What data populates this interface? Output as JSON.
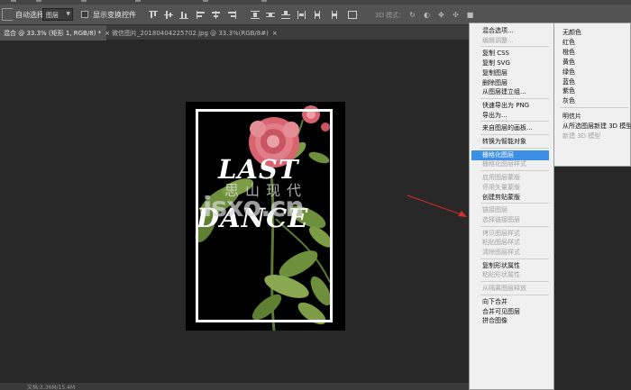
{
  "options_bar": {
    "auto_select_label": "自动选择：",
    "auto_select_value": "图层",
    "show_transform_label": "显示变换控件",
    "mode_3d_label": "3D 模式："
  },
  "tabs": [
    {
      "label": "混合 @ 33.3% (矩形 1, RGB/8) *",
      "close": "×"
    },
    {
      "label": "微信图片_20180404225702.jpg @ 33.3%(RGB/8#)",
      "close": "×"
    }
  ],
  "poster": {
    "line1": "LAST",
    "line2": "DANCE",
    "colors": {
      "rose": "#d9636e",
      "leaf": "#6e8f3c"
    }
  },
  "watermark": {
    "cn": "思山现代",
    "latin": "isxo.cn"
  },
  "status": {
    "text": "文档:3.36M/15.4M"
  },
  "context_menu": {
    "items": [
      {
        "label": "混合选项...",
        "disabled": false
      },
      {
        "label": "编辑调整...",
        "disabled": true
      },
      {
        "sep": true
      },
      {
        "label": "复制 CSS",
        "disabled": false
      },
      {
        "label": "复制 SVG",
        "disabled": false
      },
      {
        "label": "复制图层",
        "disabled": false
      },
      {
        "label": "删除图层",
        "disabled": false
      },
      {
        "label": "从图层建立组...",
        "disabled": false
      },
      {
        "sep": true
      },
      {
        "label": "快速导出为 PNG",
        "disabled": false
      },
      {
        "label": "导出为...",
        "disabled": false
      },
      {
        "sep": true
      },
      {
        "label": "来自图层的画板...",
        "disabled": false
      },
      {
        "sep": true
      },
      {
        "label": "转换为智能对象",
        "disabled": false
      },
      {
        "sep": true
      },
      {
        "label": "栅格化图层",
        "disabled": false,
        "highlighted": true
      },
      {
        "label": "栅格化图层样式",
        "disabled": true
      },
      {
        "sep": true
      },
      {
        "label": "启用图层蒙版",
        "disabled": true
      },
      {
        "label": "停用矢量蒙版",
        "disabled": true
      },
      {
        "label": "创建剪贴蒙版",
        "disabled": false
      },
      {
        "sep": true
      },
      {
        "label": "链接图层",
        "disabled": true
      },
      {
        "label": "选择链接图层",
        "disabled": true
      },
      {
        "sep": true
      },
      {
        "label": "拷贝图层样式",
        "disabled": true
      },
      {
        "label": "粘贴图层样式",
        "disabled": true
      },
      {
        "label": "清除图层样式",
        "disabled": true
      },
      {
        "sep": true
      },
      {
        "label": "复制形状属性",
        "disabled": false
      },
      {
        "label": "粘贴形状属性",
        "disabled": true
      },
      {
        "sep": true
      },
      {
        "label": "从隔离图层释放",
        "disabled": true
      },
      {
        "sep": true
      },
      {
        "label": "向下合并",
        "disabled": false
      },
      {
        "label": "合并可见图层",
        "disabled": false
      },
      {
        "label": "拼合图像",
        "disabled": false
      }
    ]
  },
  "color_submenu": {
    "items": [
      {
        "label": "无颜色",
        "disabled": false
      },
      {
        "label": "红色",
        "disabled": false
      },
      {
        "label": "橙色",
        "disabled": false
      },
      {
        "label": "黄色",
        "disabled": false
      },
      {
        "label": "绿色",
        "disabled": false
      },
      {
        "label": "蓝色",
        "disabled": false
      },
      {
        "label": "紫色",
        "disabled": false
      },
      {
        "label": "灰色",
        "disabled": false
      },
      {
        "sep": true
      },
      {
        "label": "明信片",
        "disabled": false
      },
      {
        "label": "从所选图层新建 3D 模型",
        "disabled": false
      },
      {
        "label": "新建 3D 模型",
        "disabled": true
      }
    ]
  }
}
